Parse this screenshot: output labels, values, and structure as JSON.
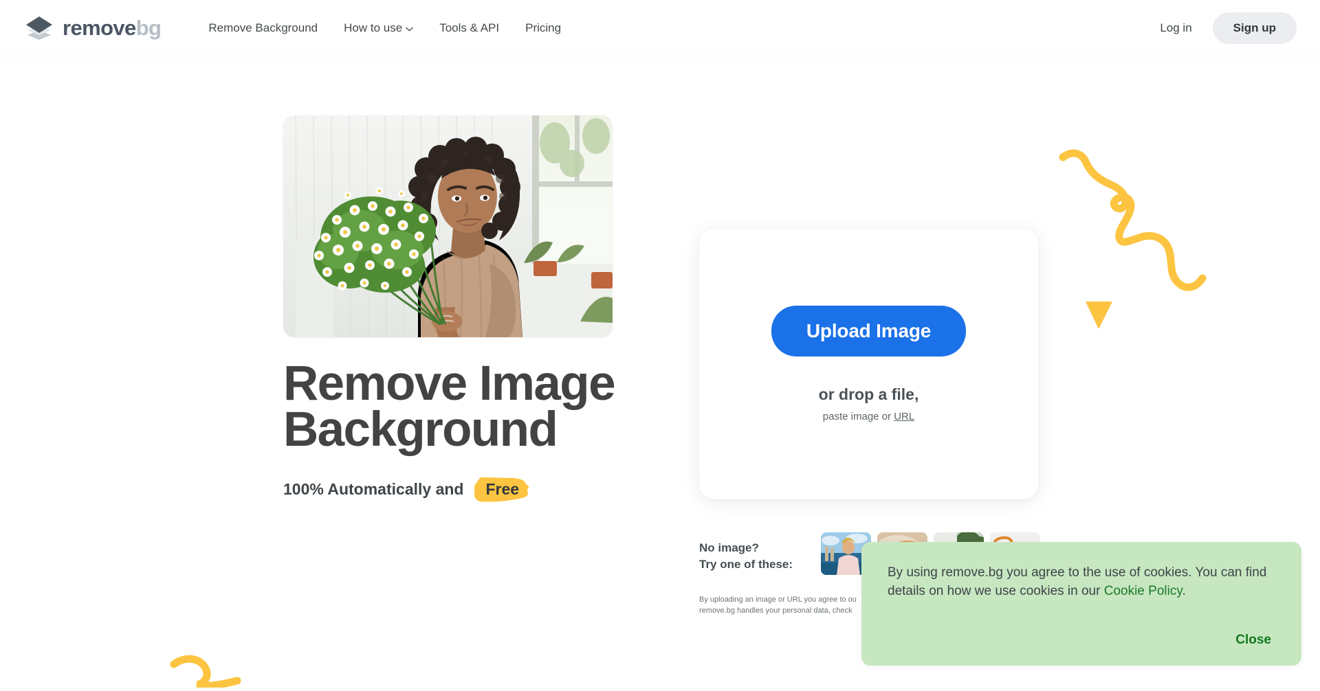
{
  "brand": {
    "logo_icon": "layers-diamond-icon",
    "name_primary": "remove",
    "name_secondary": "bg"
  },
  "header": {
    "nav": [
      {
        "label": "Remove Background",
        "icon": null
      },
      {
        "label": "How to use",
        "icon": "chevron-down-icon"
      },
      {
        "label": "Tools & API",
        "icon": null
      },
      {
        "label": "Pricing",
        "icon": null
      }
    ],
    "login_label": "Log in",
    "signup_label": "Sign up"
  },
  "hero": {
    "photo_alt": "Smiling woman with curly hair holding a bouquet of white chamomile flowers in a bright room",
    "title_line1": "Remove Image",
    "title_line2": "Background",
    "subtitle_prefix": "100% Automatically and",
    "subtitle_highlight": "Free"
  },
  "upload": {
    "button_label": "Upload Image",
    "drop_text": "or drop a file,",
    "paste_prefix": "paste image or",
    "url_link_label": "URL"
  },
  "samples": {
    "label_line1": "No image?",
    "label_line2": "Try one of these:",
    "thumbnails": [
      {
        "name": "sample-man-pink-shirt"
      },
      {
        "name": "sample-dog-portrait"
      },
      {
        "name": "sample-car-outdoors"
      },
      {
        "name": "sample-product-purple"
      }
    ]
  },
  "legal": {
    "line1": "By uploading an image or URL you agree to ou",
    "line2": "remove.bg handles your personal data, check"
  },
  "cookie_banner": {
    "text_before_link": "By using remove.bg you agree to the use of cookies. You can find details on how we use cookies in our ",
    "link_label": "Cookie Policy",
    "text_after_link": ".",
    "close_label": "Close"
  },
  "colors": {
    "accent_blue": "#1b71e8",
    "brand_dark": "#4b5563",
    "brand_light": "#b7bfc6",
    "highlight_yellow": "#fcc440",
    "cookie_green_bg": "#c7e7c1",
    "cookie_green_text": "#137a1d",
    "signup_gray": "#ecedf0",
    "heading_gray": "#434343"
  },
  "decorations": [
    {
      "name": "yellow-squiggle-right",
      "color": "#fcc440"
    },
    {
      "name": "yellow-triangle",
      "color": "#fcc440"
    },
    {
      "name": "yellow-squiggle-bottom-left",
      "color": "#fcc440"
    }
  ]
}
